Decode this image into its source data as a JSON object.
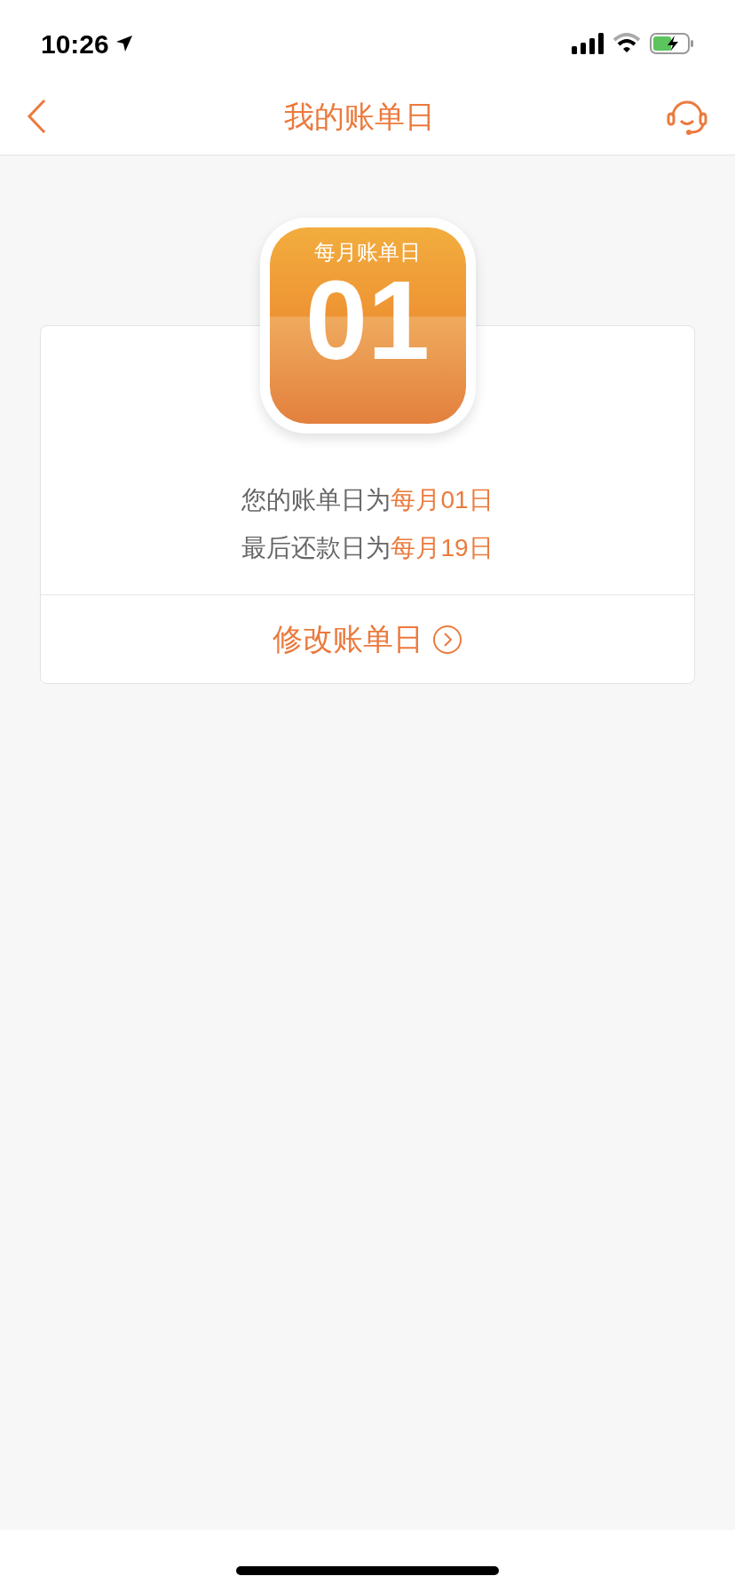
{
  "status_bar": {
    "time": "10:26"
  },
  "nav": {
    "title": "我的账单日"
  },
  "calendar": {
    "caption": "每月账单日",
    "day": "01"
  },
  "info_lines": [
    {
      "prefix": "您的账单日为",
      "highlight": "每月01日"
    },
    {
      "prefix": "最后还款日为",
      "highlight": "每月19日"
    }
  ],
  "action": {
    "label": "修改账单日"
  }
}
